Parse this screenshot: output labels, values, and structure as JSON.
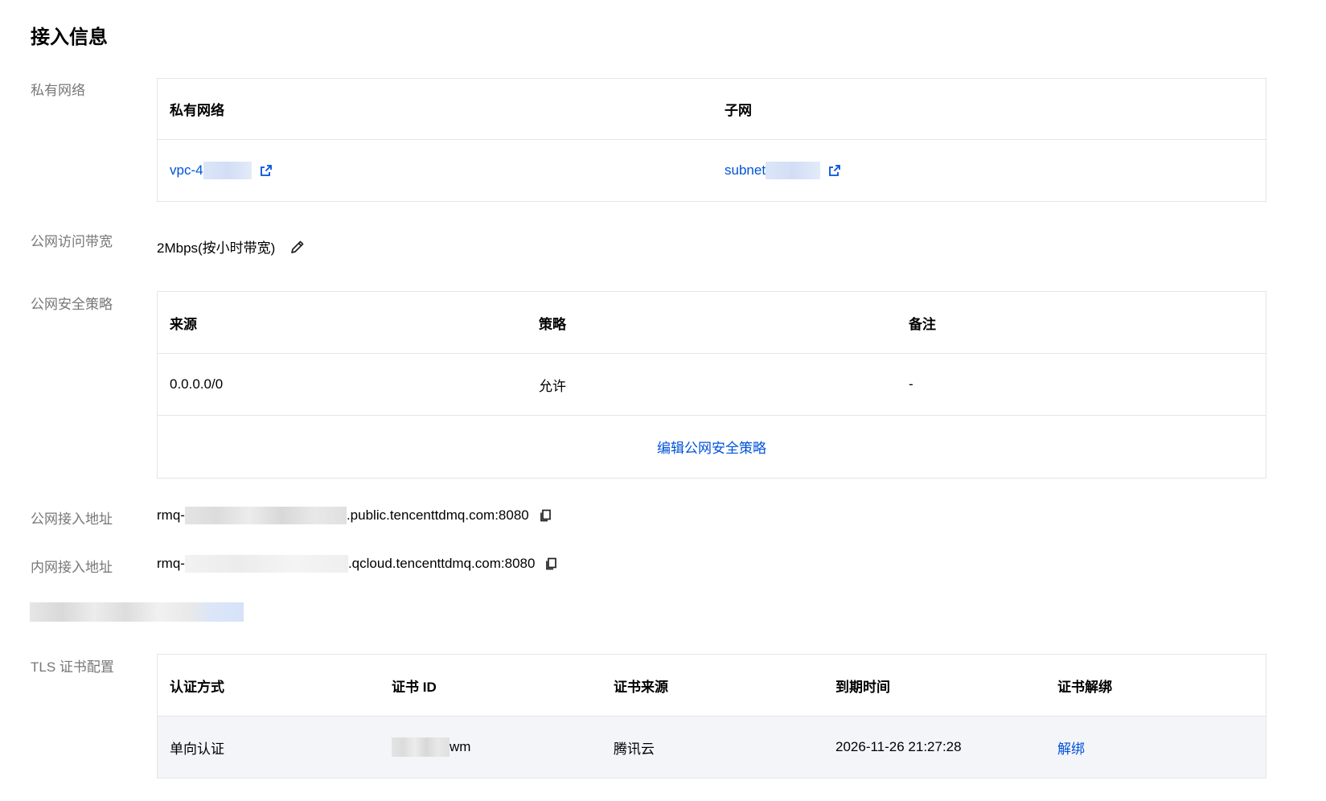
{
  "title": "接入信息",
  "vpc": {
    "label": "私有网络",
    "headers": [
      "私有网络",
      "子网"
    ],
    "vpc_value": "vpc-4",
    "subnet_value": "subnet"
  },
  "bandwidth": {
    "label": "公网访问带宽",
    "value": "2Mbps(按小时带宽)"
  },
  "security": {
    "label": "公网安全策略",
    "headers": [
      "来源",
      "策略",
      "备注"
    ],
    "rows": [
      [
        "0.0.0.0/0",
        "允许",
        "-"
      ]
    ],
    "edit_link": "编辑公网安全策略"
  },
  "public_addr": {
    "label": "公网接入地址",
    "prefix": "rmq-",
    "suffix": ".public.tencenttdmq.com:8080"
  },
  "private_addr": {
    "label": "内网接入地址",
    "prefix": "rmq-",
    "suffix": ".qcloud.tencenttdmq.com:8080"
  },
  "tls": {
    "label": "TLS 证书配置",
    "headers": [
      "认证方式",
      "证书 ID",
      "证书来源",
      "到期时间",
      "证书解绑"
    ],
    "row": {
      "auth": "单向认证",
      "cert_id_suffix": "wm",
      "source": "腾讯云",
      "expire": "2026-11-26 21:27:28",
      "unbind": "解绑"
    }
  },
  "colors": {
    "link": "#0052d9",
    "label": "#777777",
    "border": "#e5e5e5"
  }
}
